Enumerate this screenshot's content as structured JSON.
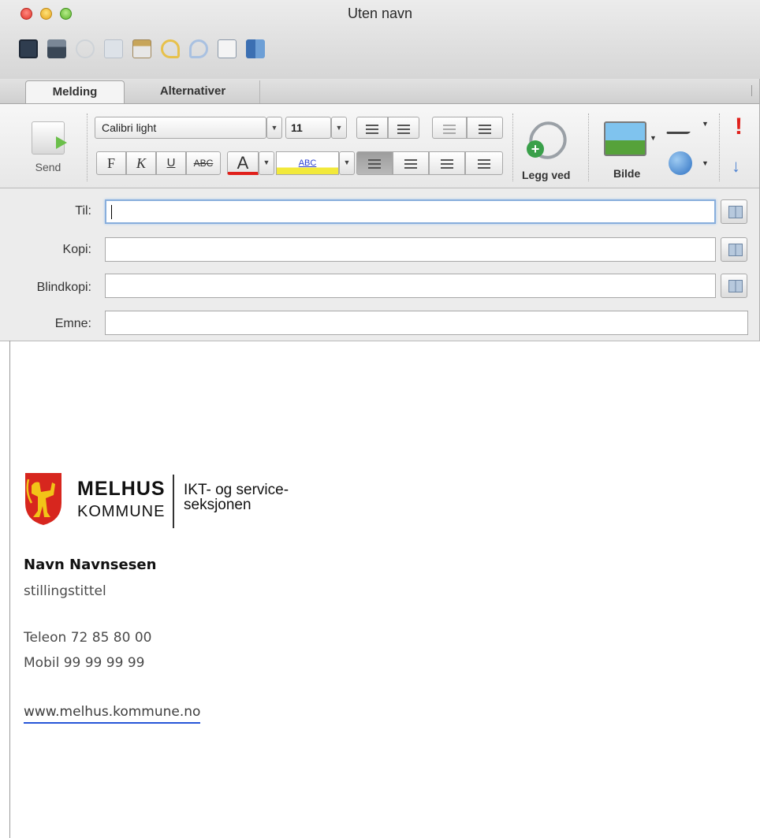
{
  "window": {
    "title": "Uten navn"
  },
  "tabs": [
    {
      "label": "Melding",
      "active": true
    },
    {
      "label": "Alternativer",
      "active": false
    }
  ],
  "ribbon": {
    "send_label": "Send",
    "font_name": "Calibri light",
    "font_size": "11",
    "bold_label": "F",
    "italic_label": "K",
    "underline_label": "U",
    "strike_label": "ABC",
    "font_color_label": "A",
    "highlight_label": "ABC",
    "attach_label": "Legg ved",
    "picture_label": "Bilde",
    "colors": {
      "font_color": "#e0201b",
      "highlight": "#f2e93a",
      "attach_plus": "#3aa04a"
    }
  },
  "fields": {
    "to_label": "Til:",
    "cc_label": "Kopi:",
    "bcc_label": "Blindkopi:",
    "subject_label": "Emne:",
    "to_value": "",
    "cc_value": "",
    "bcc_value": "",
    "subject_value": ""
  },
  "signature": {
    "brand_line1": "MELHUS",
    "brand_line2": "KOMMUNE",
    "dept_line1": "IKT- og service-",
    "dept_line2": "seksjonen",
    "name": "Navn Navnsesen",
    "role": "stillingstittel",
    "phone": "Teleon 72 85 80 00",
    "mobile": "Mobil 99 99 99 99",
    "website": "www.melhus.kommune.no",
    "colors": {
      "crest_red": "#d7261e",
      "crest_gold": "#f2c318",
      "link_underline": "#2656d8"
    }
  }
}
